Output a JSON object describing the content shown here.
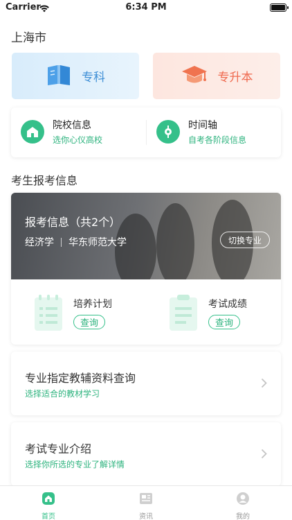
{
  "status_bar": {
    "carrier": "Carrier",
    "time": "6:34 PM"
  },
  "location": {
    "city": "上海市"
  },
  "categories": [
    {
      "label": "专科",
      "icon": "book-icon"
    },
    {
      "label": "专升本",
      "icon": "graduation-cap-icon"
    }
  ],
  "info_links": [
    {
      "title": "院校信息",
      "subtitle": "选你心仪高校",
      "icon": "school-icon"
    },
    {
      "title": "时间轴",
      "subtitle": "自考各阶段信息",
      "icon": "timeline-icon"
    }
  ],
  "exam_section": {
    "heading": "考生报考信息",
    "banner_title": "报考信息（共2个）",
    "major": "经济学",
    "school": "华东师范大学",
    "switch_label": "切换专业",
    "actions": [
      {
        "title": "培养计划",
        "button": "查询",
        "icon": "plan-doc-icon"
      },
      {
        "title": "考试成绩",
        "button": "查询",
        "icon": "score-clipboard-icon"
      }
    ]
  },
  "list_items": [
    {
      "title": "专业指定教辅资料查询",
      "subtitle": "选择适合的教材学习"
    },
    {
      "title": "考试专业介绍",
      "subtitle": "选择你所选的专业了解详情"
    }
  ],
  "tab_bar": {
    "active": "首页",
    "tabs": [
      {
        "label": "首页",
        "icon": "home-icon"
      },
      {
        "label": "资讯",
        "icon": "news-icon"
      },
      {
        "label": "我的",
        "icon": "profile-icon"
      }
    ]
  },
  "colors": {
    "accent": "#35c08a",
    "blue": "#3f8fd6",
    "orange": "#ef6a4f"
  }
}
